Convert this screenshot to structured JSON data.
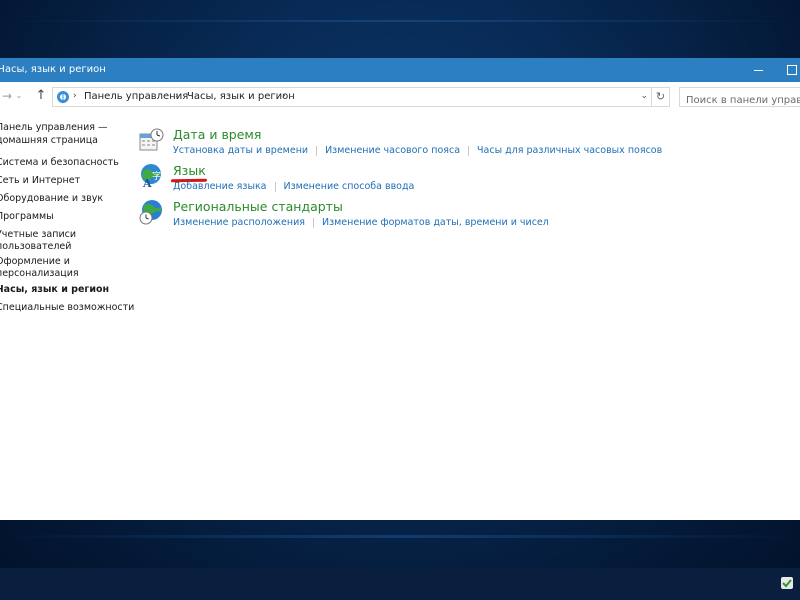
{
  "window": {
    "title": "Часы, язык и регион"
  },
  "nav": {
    "back_icon": "arrow-left-icon",
    "forward_icon": "arrow-right-icon",
    "up_icon": "arrow-up-icon",
    "breadcrumbs": [
      "Панель управления",
      "Часы, язык и регион"
    ],
    "search_placeholder": "Поиск в панели управле..."
  },
  "sidebar": {
    "items": [
      {
        "label": "Панель управления —"
      },
      {
        "label": "домашняя страница"
      },
      {
        "label": "Система и безопасность"
      },
      {
        "label": "Сеть и Интернет"
      },
      {
        "label": "Оборудование и звук"
      },
      {
        "label": "Программы"
      },
      {
        "label": "Учетные записи"
      },
      {
        "label": "пользователей"
      },
      {
        "label": "Оформление и"
      },
      {
        "label": "персонализация"
      },
      {
        "label": "Часы, язык и регион"
      },
      {
        "label": "Специальные возможности"
      }
    ]
  },
  "main": {
    "categories": [
      {
        "title": "Дата и время",
        "icon": "calendar-clock-icon",
        "links": [
          "Установка даты и времени",
          "Изменение часового пояса",
          "Часы для различных часовых поясов"
        ]
      },
      {
        "title": "Язык",
        "icon": "language-icon",
        "links": [
          "Добавление языка",
          "Изменение способа ввода"
        ]
      },
      {
        "title": "Региональные стандарты",
        "icon": "globe-clock-icon",
        "links": [
          "Изменение расположения",
          "Изменение форматов даты, времени и чисел"
        ]
      }
    ]
  },
  "colors": {
    "titlebar": "#2c7fc0",
    "category_title": "#2b8a2b",
    "link": "#1e6fb8",
    "annotation": "#d9141b"
  }
}
